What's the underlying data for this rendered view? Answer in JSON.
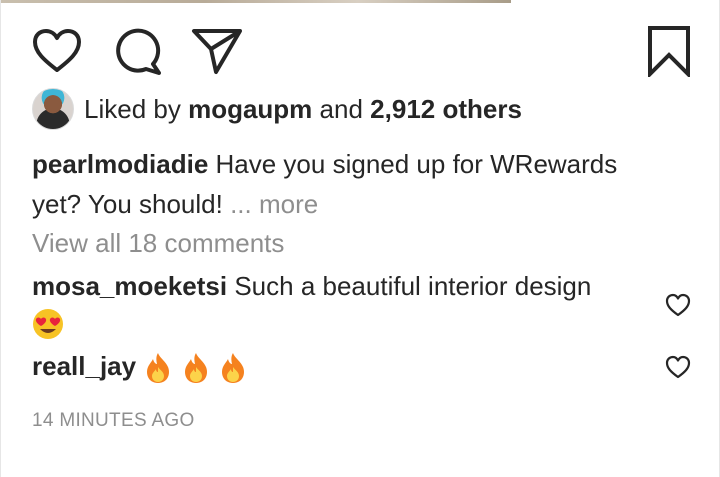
{
  "post": {
    "likes": {
      "prefix": "Liked by",
      "user": "mogaupm",
      "connector": "and",
      "count": "2,912 others"
    },
    "caption": {
      "author": "pearlmodiadie",
      "text": "Have you signed up for WRewards yet? You should!",
      "ellipsis": "...",
      "more": "more"
    },
    "view_all_comments": "View all 18 comments",
    "comments": [
      {
        "author": "mosa_moeketsi",
        "text": "Such a beautiful interior design",
        "emoji": "heart-eyes-emoji"
      },
      {
        "author": "reall_jay",
        "text": "",
        "emoji": "fire-emoji x3"
      }
    ],
    "timestamp": "14 MINUTES AGO"
  },
  "icons": {
    "like": "heart-icon",
    "comment": "comment-icon",
    "share": "paper-plane-icon",
    "save": "bookmark-icon"
  },
  "colors": {
    "text": "#262626",
    "muted": "#8e8e8e",
    "background": "#ffffff"
  }
}
